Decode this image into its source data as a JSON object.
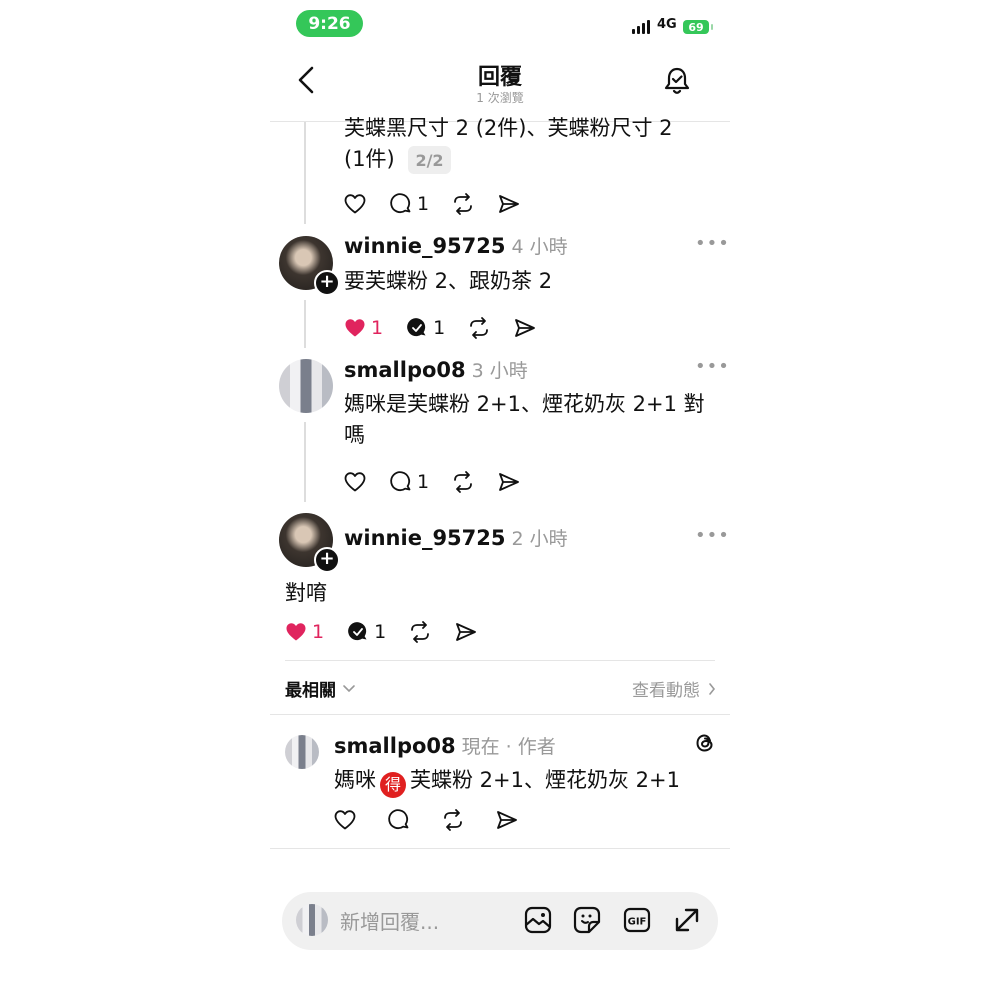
{
  "status": {
    "time": "9:26",
    "network": "4G",
    "battery": "69"
  },
  "header": {
    "title": "回覆",
    "subtitle": "1 次瀏覽"
  },
  "posts": [
    {
      "text_lines": [
        "芙蝶黑尺寸 2 (2件)、芙蝶粉尺寸 2",
        "(1件)"
      ],
      "pager": "2/2",
      "replies": "1"
    },
    {
      "username": "winnie_95725",
      "time": "4 小時",
      "text": "要芙蝶粉 2、跟奶茶 2",
      "likes": "1",
      "replies": "1"
    },
    {
      "username": "smallpo08",
      "time": "3 小時",
      "text_lines": [
        "媽咪是芙蝶粉 2+1、煙花奶灰 2+1 對",
        "嗎"
      ],
      "replies": "1"
    },
    {
      "username": "winnie_95725",
      "time": "2 小時",
      "text": "對唷",
      "likes": "1",
      "replies": "1"
    }
  ],
  "sort": {
    "label": "最相關",
    "activity": "查看動態"
  },
  "own_reply": {
    "username": "smallpo08",
    "meta": "現在 · 作者",
    "text_before": "媽咪",
    "badge": "得",
    "text_after": "芙蝶粉 2+1、煙花奶灰 2+1"
  },
  "composer": {
    "placeholder": "新增回覆..."
  },
  "icons": [
    "back-arrow-icon",
    "bell-icon",
    "heart-icon",
    "comment-icon",
    "repost-icon",
    "share-icon",
    "more-icon",
    "threads-icon",
    "image-icon",
    "sticker-icon",
    "gif-icon",
    "expand-icon"
  ],
  "colors": {
    "status_green": "#34c759",
    "like_red": "#e0245e",
    "muted": "#999999"
  }
}
